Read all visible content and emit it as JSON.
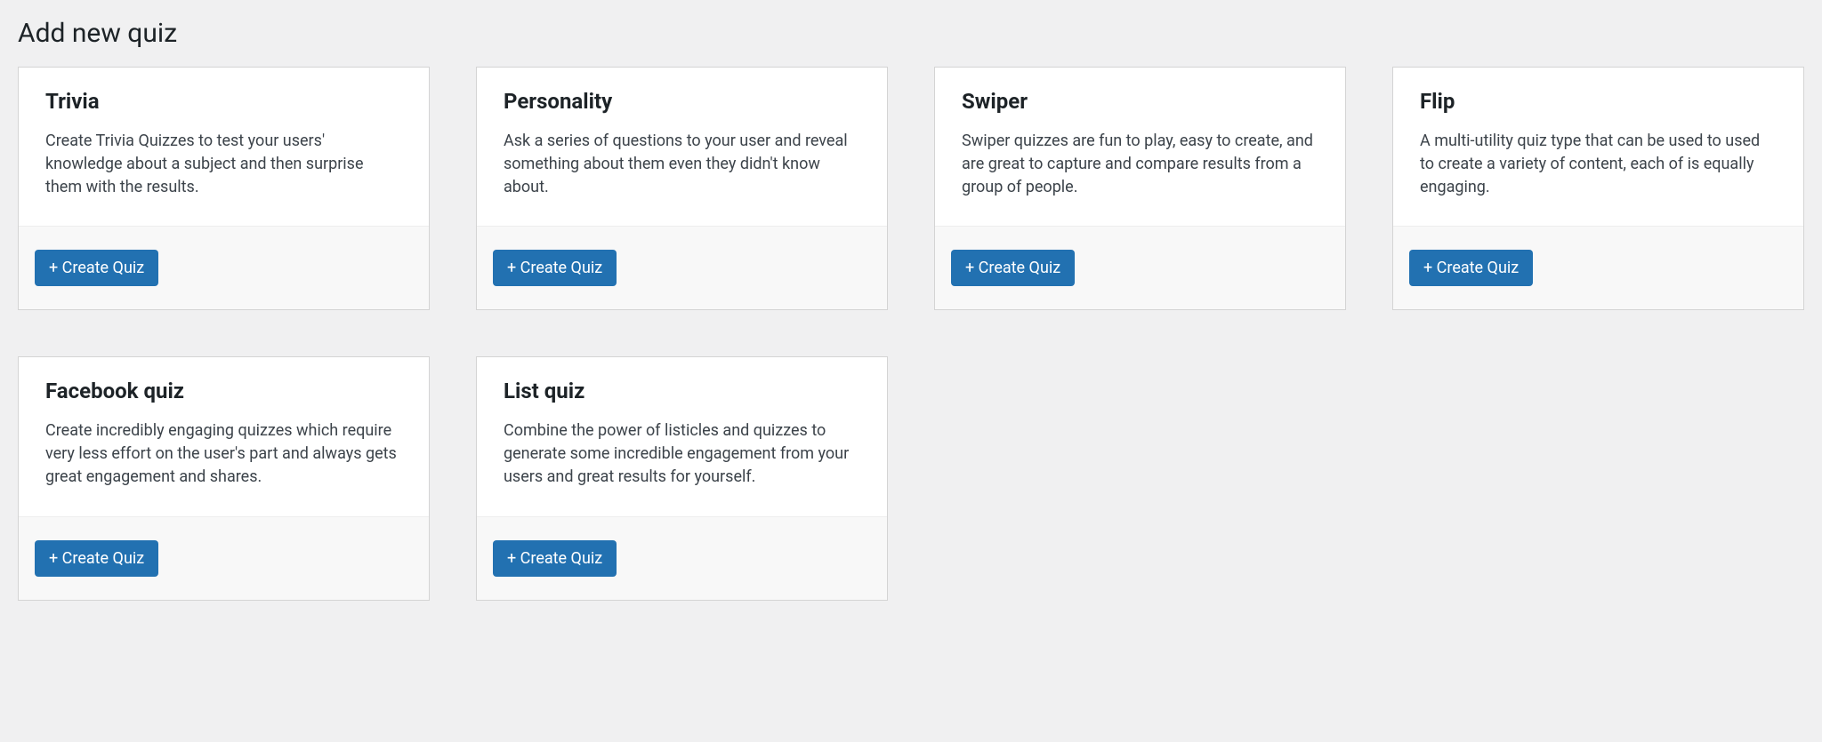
{
  "page_title": "Add new quiz",
  "create_label": "+ Create Quiz",
  "cards": [
    {
      "title": "Trivia",
      "desc": "Create Trivia Quizzes to test your users' knowledge about a subject and then surprise them with the results."
    },
    {
      "title": "Personality",
      "desc": "Ask a series of questions to your user and reveal something about them even they didn't know about."
    },
    {
      "title": "Swiper",
      "desc": "Swiper quizzes are fun to play, easy to create, and are great to capture and compare results from a group of people."
    },
    {
      "title": "Flip",
      "desc": "A multi-utility quiz type that can be used to used to create a variety of content, each of is equally engaging."
    },
    {
      "title": "Facebook quiz",
      "desc": "Create incredibly engaging quizzes which require very less effort on the user's part and always gets great engagement and shares."
    },
    {
      "title": "List quiz",
      "desc": "Combine the power of listicles and quizzes to generate some incredible engagement from your users and great results for yourself."
    }
  ]
}
